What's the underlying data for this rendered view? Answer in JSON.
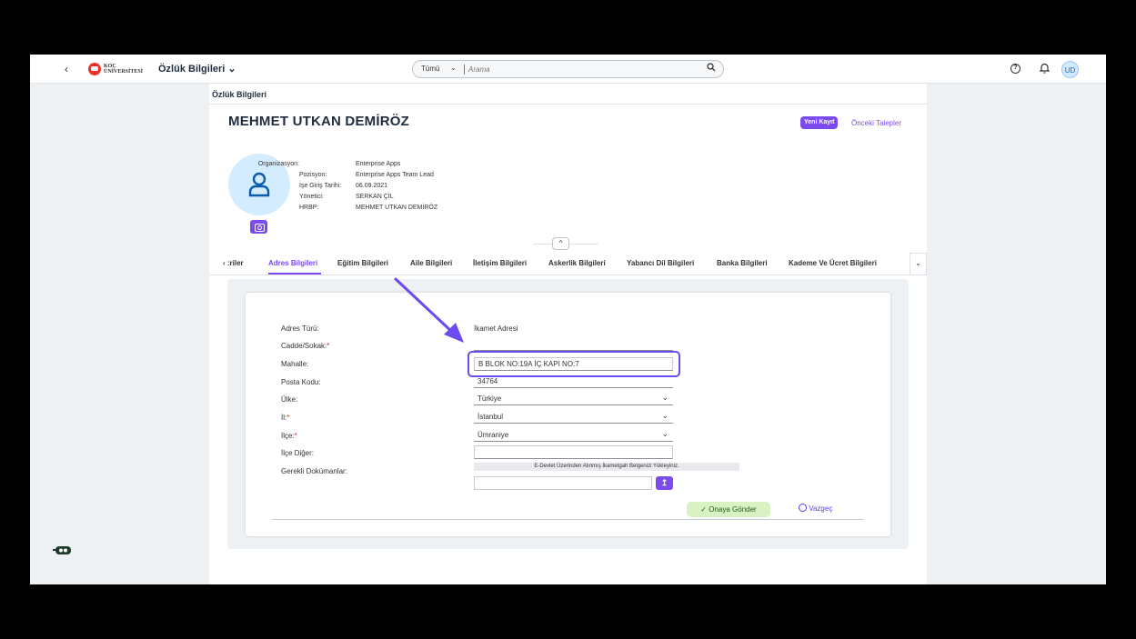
{
  "shellbar": {
    "back_icon": "‹",
    "logo_lines": [
      "KOÇ",
      "ÜNİVERSİTESİ"
    ],
    "app_title": "Özlük Bilgileri ⌄",
    "search_scope": "Tümü",
    "search_placeholder": "Arama",
    "help_icon": "?",
    "avatar_initials": "UD"
  },
  "page": {
    "header": "Özlük Bilgileri",
    "employee_name": "MEHMET UTKAN DEMİRÖZ",
    "new_record_label": "Yeni Kayıt",
    "prev_requests_label": "Önceki Talepler"
  },
  "info": [
    {
      "label": "Organizasyon:",
      "value": "Enterprise Apps"
    },
    {
      "label": "Pozisyon:",
      "value": "Enterprise Apps Team Lead"
    },
    {
      "label": "İşe Giriş Tarihi:",
      "value": "06.09.2021"
    },
    {
      "label": "Yönetici:",
      "value": "SERKAN ÇİL"
    },
    {
      "label": "HRBP:",
      "value": "MEHMET UTKAN DEMİRÖZ"
    }
  ],
  "tabs": [
    {
      "label": "‹ :riler",
      "active": false
    },
    {
      "label": "Adres Bilgileri",
      "active": true
    },
    {
      "label": "Eğitim Bilgileri",
      "active": false
    },
    {
      "label": "Aile Bilgileri",
      "active": false
    },
    {
      "label": "İletişim Bilgileri",
      "active": false
    },
    {
      "label": "Askerlik Bilgileri",
      "active": false
    },
    {
      "label": "Yabancı Dil Bilgileri",
      "active": false
    },
    {
      "label": "Banka Bilgileri",
      "active": false
    },
    {
      "label": "Kademe Ve Ücret Bilgileri",
      "active": false
    }
  ],
  "form": {
    "labels": {
      "adres_turu": "Adres Türü:",
      "cadde": "Cadde/Sokak:",
      "mahalle": "Mahalle:",
      "posta_kodu": "Posta Kodu:",
      "ulke": "Ülke:",
      "il": "İl:",
      "ilce": "İlçe:",
      "ilce_diger": "İlçe Diğer:",
      "gerekli_dokumanlar": "Gerekli Dokümanlar:"
    },
    "required_mark": "*",
    "adres_turu_value": "İkamet Adresi",
    "cadde_value": "",
    "mahalle_value": "B BLOK NO:19A İÇ KAPI NO:7",
    "posta_kodu_value": "34764",
    "ulke_value": "Türkiye",
    "il_value": "İstanbul",
    "ilce_value": "Ümraniye",
    "ilce_diger_value": "",
    "document_note": "E-Devlet Üzerinden Alınmış İkametgah Belgenizi Yükleyiniz.",
    "upload_icon": "↥",
    "submit_label": "✓  Onaya Gönder",
    "cancel_label": "Vazgeç"
  },
  "colors": {
    "accent": "#7b4bf0",
    "highlight": "#6c4cf0",
    "submit_bg": "#d9f2c4"
  }
}
